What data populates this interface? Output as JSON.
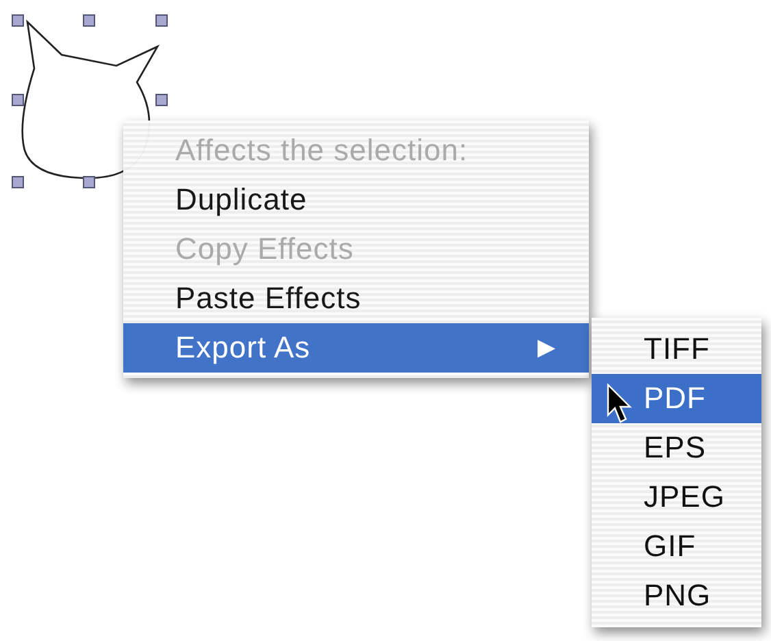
{
  "menu": {
    "items": [
      {
        "kind": "header",
        "label": "Affects the selection:",
        "disabled": true,
        "selected": false
      },
      {
        "kind": "item",
        "label": "Duplicate",
        "disabled": false,
        "selected": false
      },
      {
        "kind": "item",
        "label": "Copy Effects",
        "disabled": true,
        "selected": false
      },
      {
        "kind": "item",
        "label": "Paste Effects",
        "disabled": false,
        "selected": false
      },
      {
        "kind": "submenu",
        "label": "Export As",
        "arrow": "▶",
        "disabled": false,
        "selected": true
      }
    ]
  },
  "submenu": {
    "items": [
      {
        "label": "TIFF",
        "selected": false
      },
      {
        "label": "PDF",
        "selected": true
      },
      {
        "label": "EPS",
        "selected": false
      },
      {
        "label": "JPEG",
        "selected": false
      },
      {
        "label": "GIF",
        "selected": false
      },
      {
        "label": "PNG",
        "selected": false
      }
    ]
  }
}
